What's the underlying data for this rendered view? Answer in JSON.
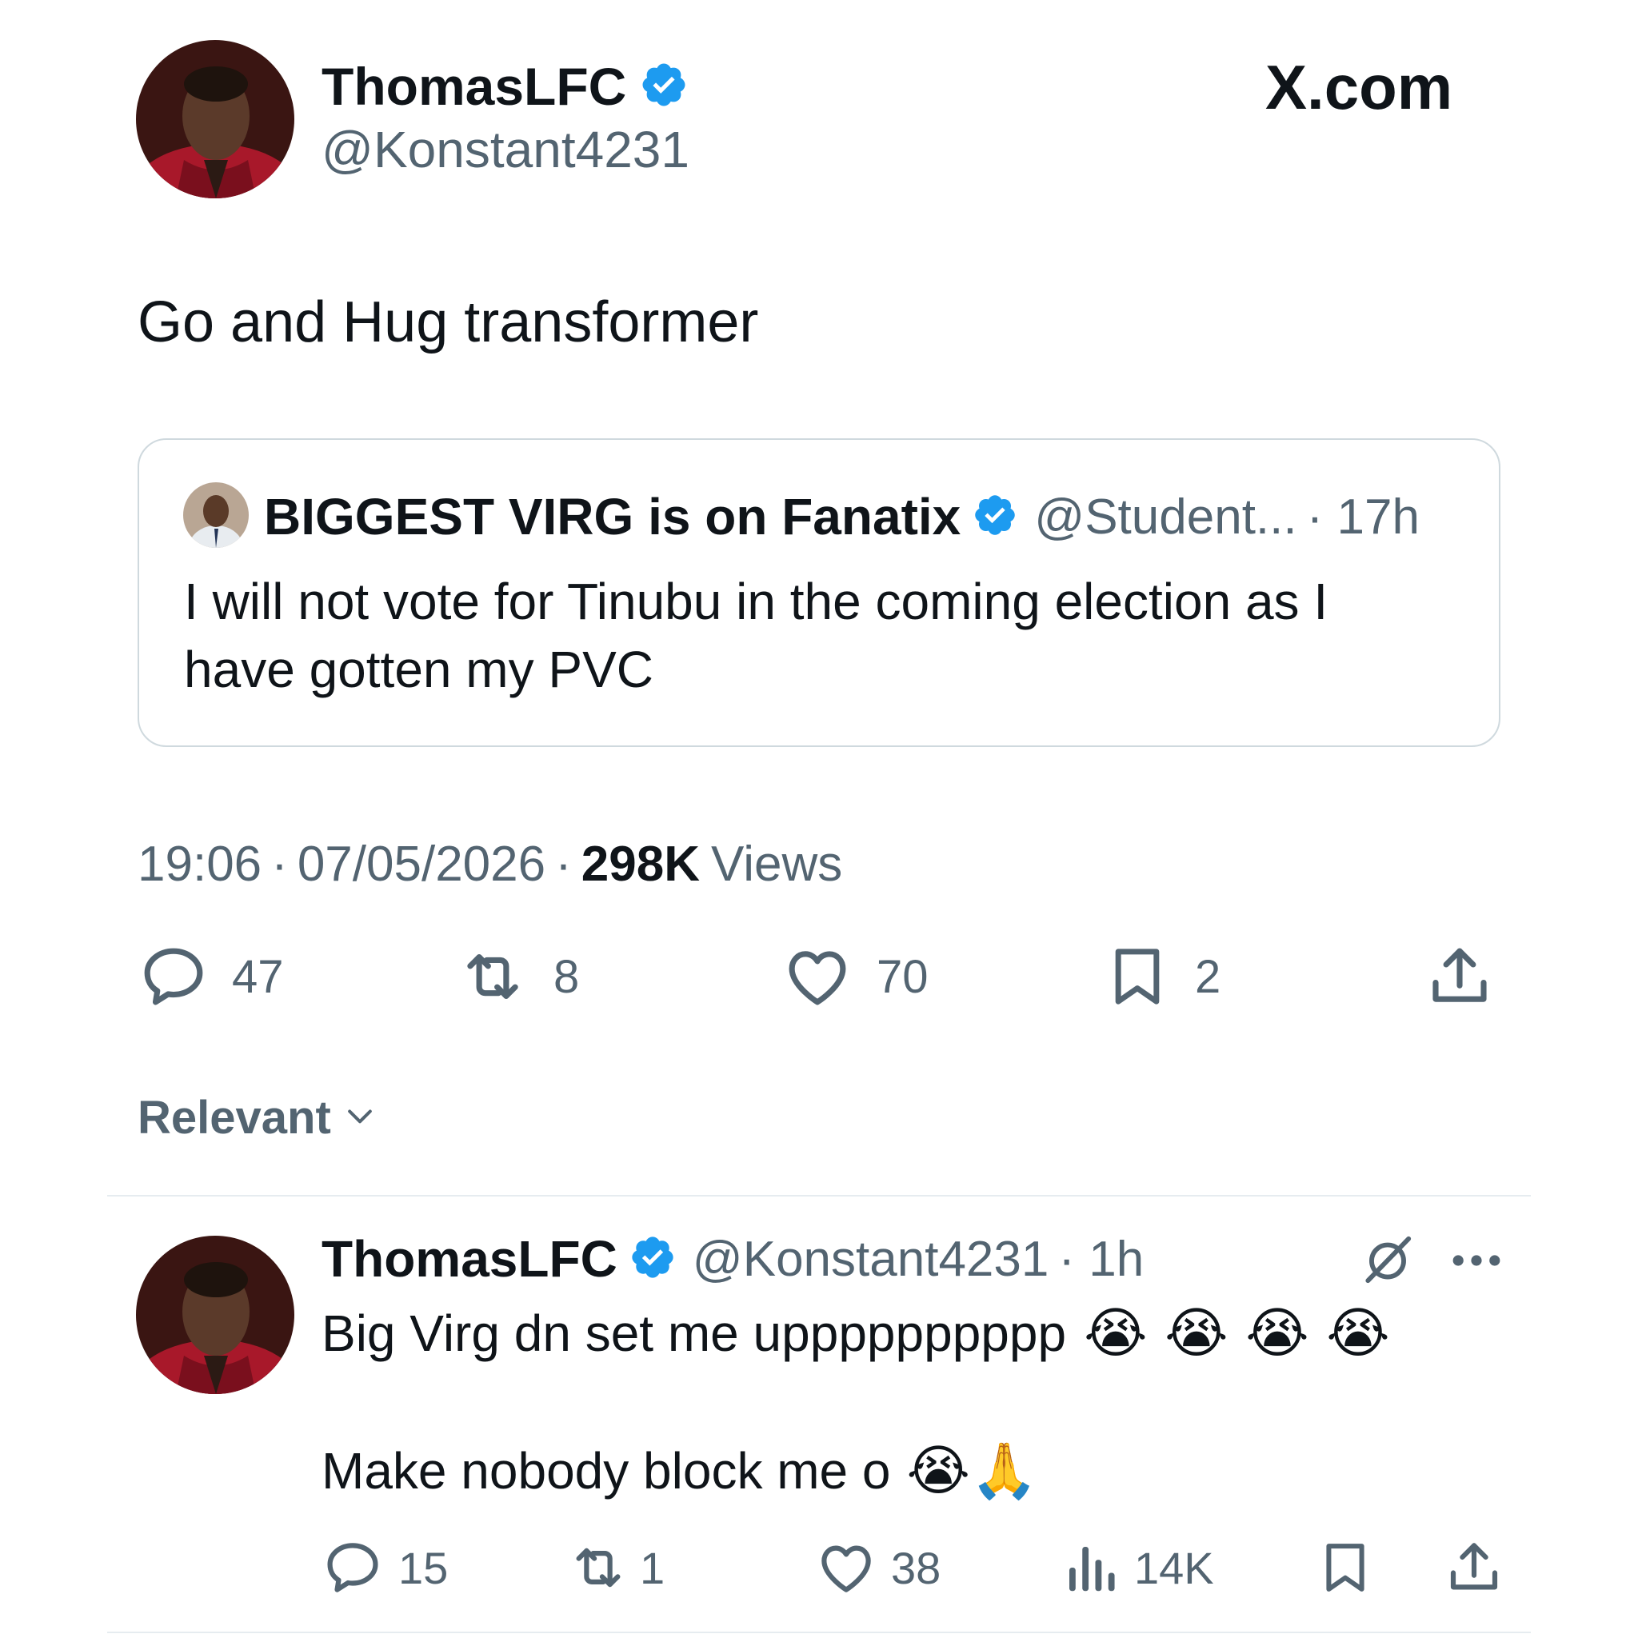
{
  "header": {
    "display_name": "ThomasLFC",
    "handle": "@Konstant4231",
    "site_brand": "X.com"
  },
  "tweet": {
    "text": "Go and Hug transformer",
    "quoted": {
      "display_name": "BIGGEST VIRG is on Fanatix",
      "handle": "@Student...",
      "time": "· 17h",
      "text_line1": "I will not vote for Tinubu in the coming election as I",
      "text_line2": "have gotten my PVC"
    },
    "meta": {
      "time": "19:06",
      "sep1": "·",
      "date": "07/05/2026",
      "sep2": "·",
      "views_count": "298K",
      "views_label": "Views"
    },
    "actions": {
      "replies": "47",
      "reposts": "8",
      "likes": "70",
      "bookmarks": "2"
    }
  },
  "sort": {
    "label": "Relevant"
  },
  "reply": {
    "display_name": "ThomasLFC",
    "handle": "@Konstant4231",
    "time": "· 1h",
    "line1": "Big Virg dn set me upppppppppp",
    "line1_emojis": "😭 😭 😭 😭",
    "line2": "Make nobody block me o",
    "line2_emojis": "😭🙏",
    "actions": {
      "replies": "15",
      "reposts": "1",
      "likes": "38",
      "views": "14K"
    }
  },
  "colors": {
    "text": "#0f1419",
    "muted": "#536471",
    "verified": "#1d9bf0",
    "border": "#cfd9de"
  },
  "icons": [
    "verified-badge-icon",
    "reply-icon",
    "repost-icon",
    "like-icon",
    "bookmark-icon",
    "share-icon",
    "chevron-down-icon",
    "grok-icon",
    "more-icon",
    "views-icon"
  ]
}
